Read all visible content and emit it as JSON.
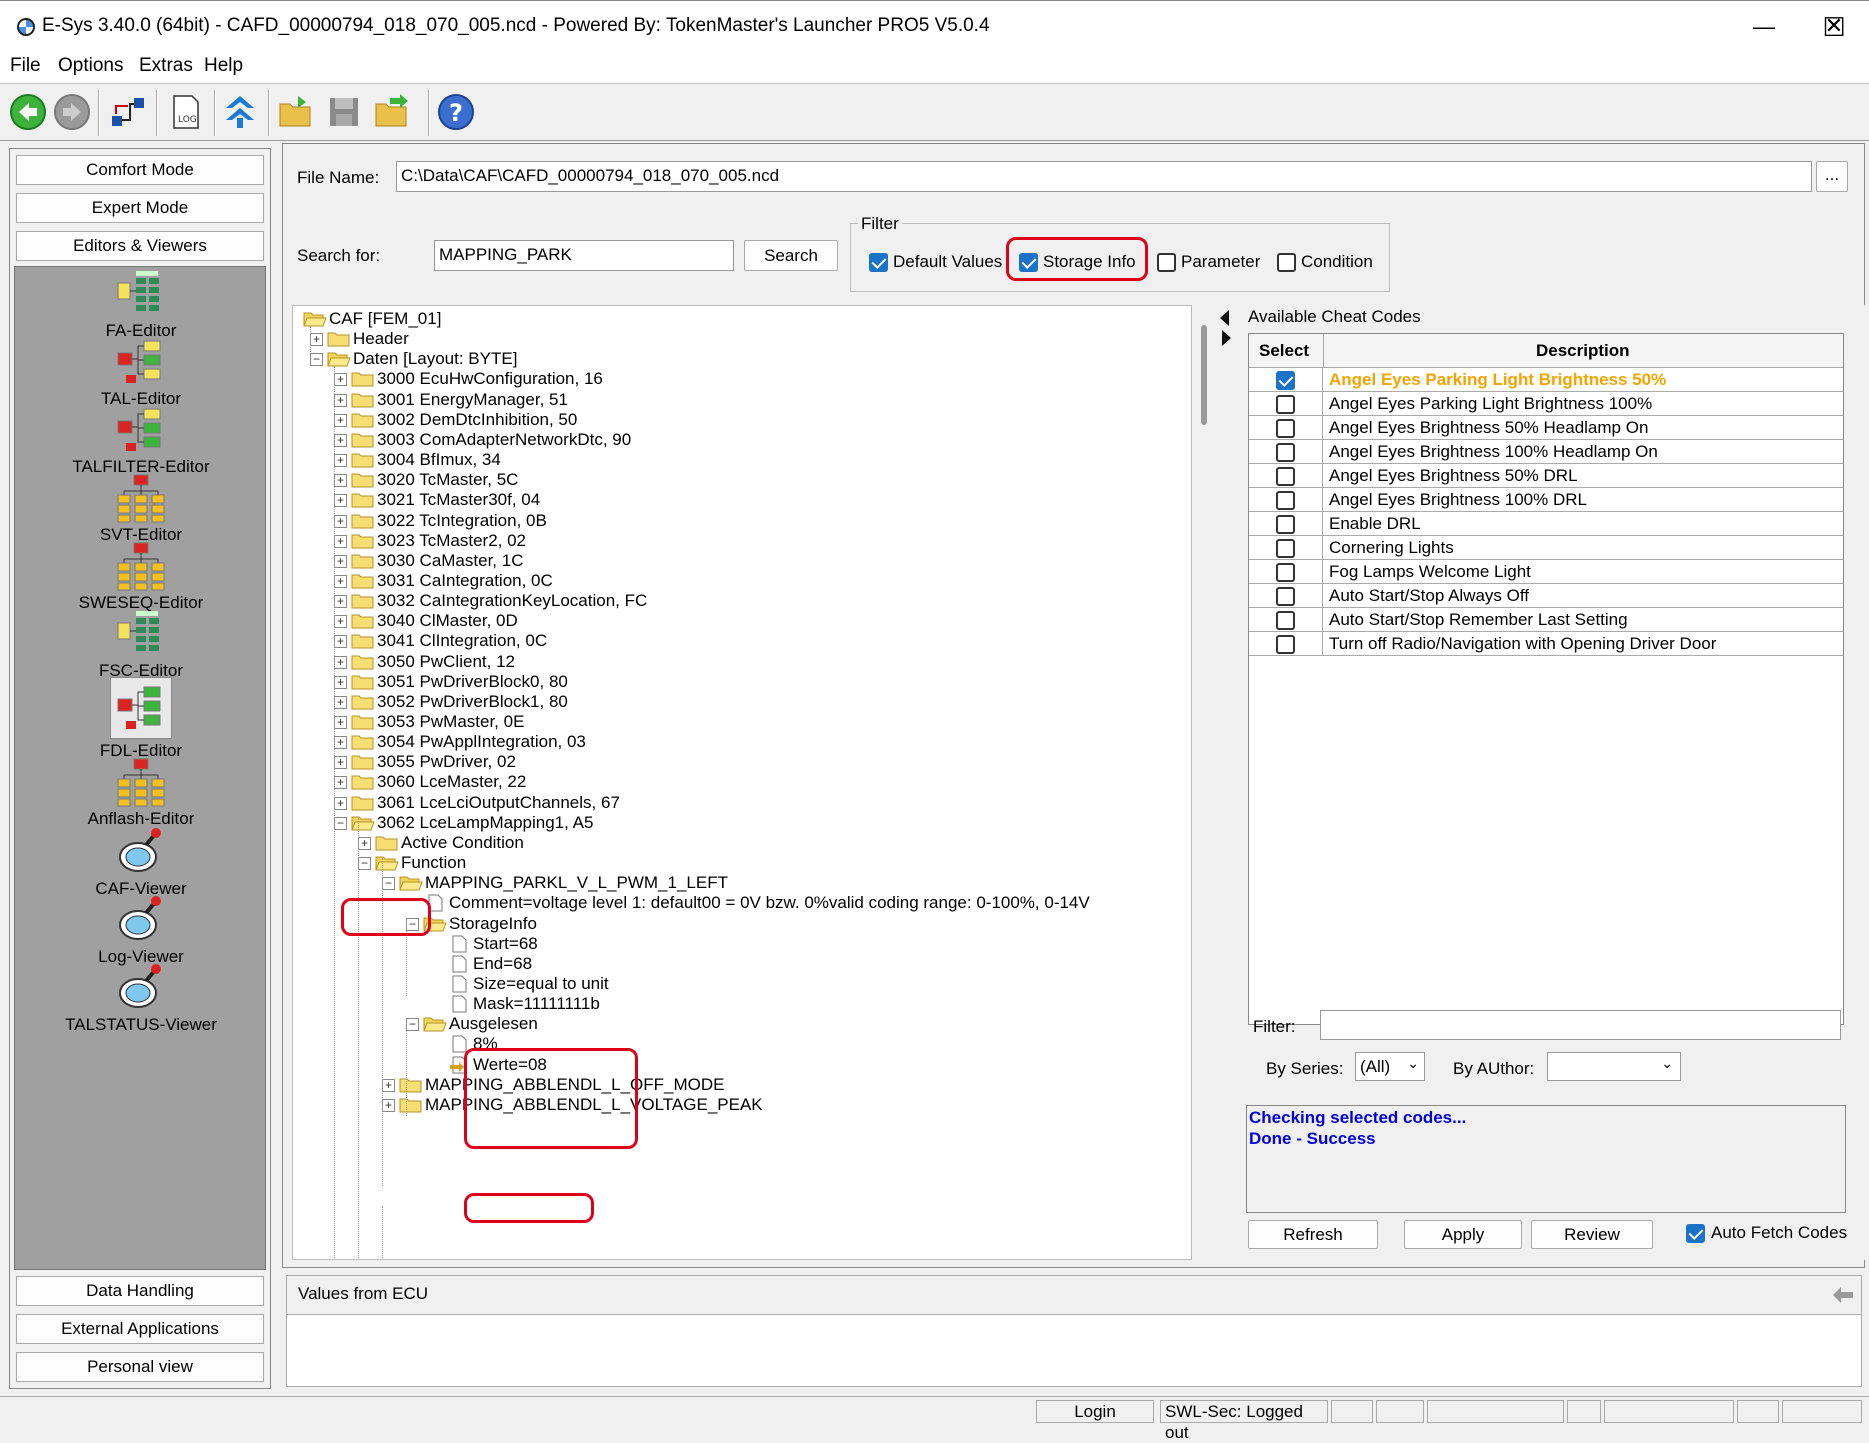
{
  "window": {
    "title": "E-Sys 3.40.0  (64bit) - CAFD_00000794_018_070_005.ncd   - Powered By: TokenMaster's Launcher PRO5 V5.0.4",
    "minimize": "—",
    "maximize": "☐",
    "close": "✕"
  },
  "menu": [
    "File",
    "Options",
    "Extras",
    "Help"
  ],
  "left": {
    "top_buttons": [
      "Comfort Mode",
      "Expert Mode",
      "Editors & Viewers"
    ],
    "tools": [
      "FA-Editor",
      "TAL-Editor",
      "TALFILTER-Editor",
      "SVT-Editor",
      "SWESEQ-Editor",
      "FSC-Editor",
      "FDL-Editor",
      "Anflash-Editor",
      "CAF-Viewer",
      "Log-Viewer",
      "TALSTATUS-Viewer"
    ],
    "bottom_buttons": [
      "Data Handling",
      "External Applications",
      "Personal view"
    ]
  },
  "file": {
    "label": "File Name:",
    "value": "C:\\Data\\CAF\\CAFD_00000794_018_070_005.ncd",
    "browse": "..."
  },
  "search": {
    "label": "Search for:",
    "value": "MAPPING_PARK",
    "button": "Search"
  },
  "filter": {
    "title": "Filter",
    "default_values": "Default Values",
    "storage_info": "Storage Info",
    "parameter": "Parameter",
    "condition": "Condition"
  },
  "tree": [
    "CAF [FEM_01]",
    "Header",
    "Daten [Layout: BYTE]",
    "3000 EcuHwConfiguration, 16",
    "3001 EnergyManager, 51",
    "3002 DemDtcInhibition, 50",
    "3003 ComAdapterNetworkDtc, 90",
    "3004 BfImux, 34",
    "3020 TcMaster, 5C",
    "3021 TcMaster30f, 04",
    "3022 TcIntegration, 0B",
    "3023 TcMaster2, 02",
    "3030 CaMaster, 1C",
    "3031 CaIntegration, 0C",
    "3032 CaIntegrationKeyLocation, FC",
    "3040 ClMaster, 0D",
    "3041 ClIntegration, 0C",
    "3050 PwClient, 12",
    "3051 PwDriverBlock0, 80",
    "3052 PwDriverBlock1, 80",
    "3053 PwMaster, 0E",
    "3054 PwApplIntegration, 03",
    "3055 PwDriver, 02",
    "3060 LceMaster, 22",
    "3061 LceLciOutputChannels, 67",
    "3062 LceLampMapping1, A5",
    "Active Condition",
    "Function",
    "MAPPING_PARKL_V_L_PWM_1_LEFT",
    "Comment=voltage level 1: default00 = 0V bzw. 0%valid coding range: 0-100%, 0-14V",
    "StorageInfo",
    "Start=68",
    "End=68",
    "Size=equal to unit",
    "Mask=11111111b",
    "Ausgelesen",
    "8%",
    "Werte=08",
    "MAPPING_ABBLENDL_L_OFF_MODE",
    "MAPPING_ABBLENDL_L_VOLTAGE_PEAK"
  ],
  "cheat": {
    "title": "Available Cheat Codes",
    "col_select": "Select",
    "col_description": "Description",
    "rows": [
      {
        "desc": "Angel Eyes Parking Light Brightness 50%",
        "checked": true
      },
      {
        "desc": "Angel Eyes Parking Light Brightness 100%",
        "checked": false
      },
      {
        "desc": "Angel Eyes Brightness 50% Headlamp On",
        "checked": false
      },
      {
        "desc": "Angel Eyes Brightness 100% Headlamp On",
        "checked": false
      },
      {
        "desc": "Angel Eyes Brightness 50% DRL",
        "checked": false
      },
      {
        "desc": "Angel Eyes Brightness 100% DRL",
        "checked": false
      },
      {
        "desc": "Enable DRL",
        "checked": false
      },
      {
        "desc": "Cornering Lights",
        "checked": false
      },
      {
        "desc": "Fog Lamps Welcome Light",
        "checked": false
      },
      {
        "desc": "Auto Start/Stop Always Off",
        "checked": false
      },
      {
        "desc": "Auto Start/Stop Remember Last Setting",
        "checked": false
      },
      {
        "desc": "Turn off Radio/Navigation with Opening Driver Door",
        "checked": false
      }
    ],
    "filter_label": "Filter:",
    "by_series_label": "By Series:",
    "by_series_value": "(All)",
    "by_author_label": "By AUthor:",
    "by_author_value": "",
    "log": [
      "Checking selected codes...",
      "Done - Success"
    ],
    "refresh": "Refresh",
    "apply": "Apply",
    "review": "Review",
    "auto_fetch": "Auto Fetch Codes"
  },
  "ecu": {
    "title": "Values from ECU"
  },
  "status": {
    "login": "Login",
    "swl": "SWL-Sec: Logged out"
  },
  "colors": {
    "highlight": "#f5a300",
    "log_text": "#0000e0",
    "red_annotation": "#e0001a"
  }
}
